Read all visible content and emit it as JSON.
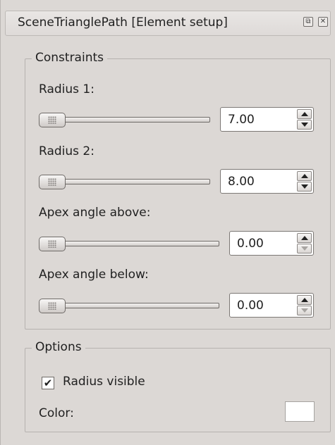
{
  "window": {
    "title": "SceneTrianglePath [Element setup]",
    "icons": [
      "float-icon",
      "close-icon"
    ]
  },
  "constraints": {
    "legend": "Constraints",
    "rows": [
      {
        "label": "Radius 1:",
        "value": "7.00",
        "down_enabled": true
      },
      {
        "label": "Radius 2:",
        "value": "8.00",
        "down_enabled": true
      },
      {
        "label": "Apex angle above:",
        "value": "0.00",
        "down_enabled": false
      },
      {
        "label": "Apex angle below:",
        "value": "0.00",
        "down_enabled": false
      }
    ]
  },
  "options": {
    "legend": "Options",
    "radius_visible_label": "Radius visible",
    "radius_visible_checked": "✔",
    "color_label": "Color:",
    "color_value": "#ffffff"
  }
}
